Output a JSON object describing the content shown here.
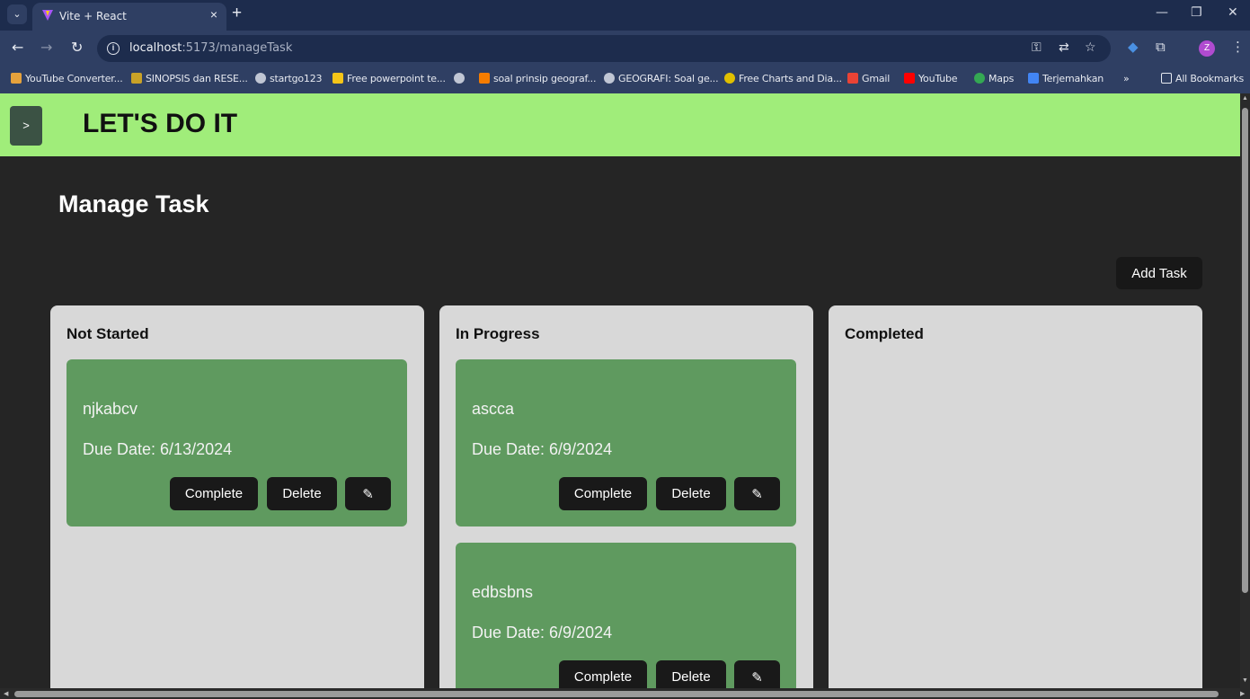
{
  "browser": {
    "tab_title": "Vite + React",
    "tab_close": "×",
    "new_tab": "+",
    "tab_menu": "⌄",
    "url_host": "localhost",
    "url_path": ":5173/manageTask",
    "window_controls": [
      "—",
      "❐",
      "✕"
    ],
    "nav": {
      "back": "←",
      "forward": "→",
      "reload": "↻"
    },
    "bookmarks": [
      {
        "label": "YouTube Converter...",
        "color": "#e6a23c"
      },
      {
        "label": "SINOPSIS dan RESE...",
        "color": "#c9a227"
      },
      {
        "label": "startgo123",
        "color": "#c0c6d4"
      },
      {
        "label": "Free powerpoint te...",
        "color": "#f5c518"
      },
      {
        "label": "",
        "color": "#c0c6d4"
      },
      {
        "label": "soal prinsip geograf...",
        "color": "#f57c00"
      },
      {
        "label": "GEOGRAFI: Soal ge...",
        "color": "#c0c6d4"
      },
      {
        "label": "Free Charts and Dia...",
        "color": "#e0c000"
      },
      {
        "label": "Gmail",
        "color": "#ea4335"
      },
      {
        "label": "YouTube",
        "color": "#ff0000"
      },
      {
        "label": "Maps",
        "color": "#34a853"
      },
      {
        "label": "Terjemahkan",
        "color": "#4285f4"
      }
    ],
    "bookmarks_more": "»",
    "all_bookmarks": "All Bookmarks",
    "profile_initial": "Z"
  },
  "app": {
    "title": "LET'S DO IT",
    "sidebar_toggle": ">",
    "header_color": "#a0ed7a"
  },
  "page": {
    "title": "Manage Task",
    "add_task_label": "Add Task"
  },
  "columns": [
    {
      "title": "Not Started",
      "tasks": [
        {
          "name": "njkabcv",
          "due": "Due Date: 6/13/2024",
          "complete": "Complete",
          "delete": "Delete",
          "edit": "✎"
        }
      ]
    },
    {
      "title": "In Progress",
      "tasks": [
        {
          "name": "ascca",
          "due": "Due Date: 6/9/2024",
          "complete": "Complete",
          "delete": "Delete",
          "edit": "✎"
        },
        {
          "name": "edbsbns",
          "due": "Due Date: 6/9/2024",
          "complete": "Complete",
          "delete": "Delete",
          "edit": "✎"
        }
      ]
    },
    {
      "title": "Completed",
      "tasks": []
    }
  ],
  "colors": {
    "card": "#5f9a5f",
    "column": "#d8d8d8",
    "background": "#252525"
  }
}
